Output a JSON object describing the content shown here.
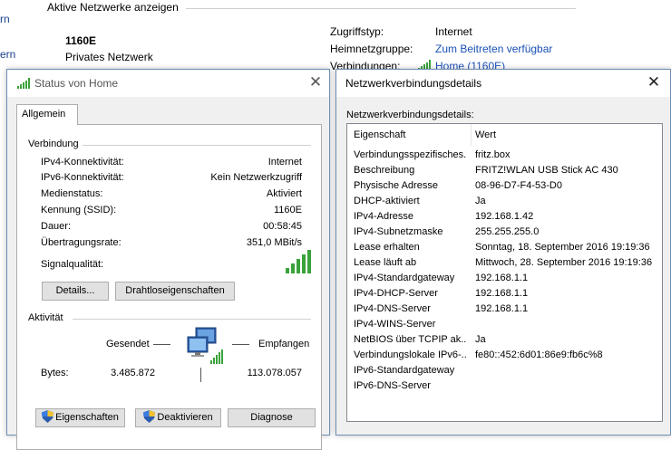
{
  "background": {
    "left_links": [
      "rn",
      "ern"
    ],
    "group_title": "Aktive Netzwerke anzeigen",
    "network_name": "1160E",
    "network_type": "Privates Netzwerk",
    "access_type_label": "Zugriffstyp:",
    "access_type_value": "Internet",
    "homegroup_label": "Heimnetzgruppe:",
    "homegroup_value": "Zum Beitreten verfügbar",
    "connections_label": "Verbindungen:",
    "connections_value": "Home (1160E)"
  },
  "status_dialog": {
    "title": "Status von Home",
    "tab_label": "Allgemein",
    "connection_group": "Verbindung",
    "rows": [
      {
        "label": "IPv4-Konnektivität:",
        "value": "Internet"
      },
      {
        "label": "IPv6-Konnektivität:",
        "value": "Kein Netzwerkzugriff"
      },
      {
        "label": "Medienstatus:",
        "value": "Aktiviert"
      },
      {
        "label": "Kennung (SSID):",
        "value": "1160E"
      },
      {
        "label": "Dauer:",
        "value": "00:58:45"
      },
      {
        "label": "Übertragungsrate:",
        "value": "351,0 MBit/s"
      }
    ],
    "signal_label": "Signalqualität:",
    "signal_bars_lit": 5,
    "signal_bars_total": 5,
    "details_button": "Details...",
    "wireless_props_button": "Drahtloseigenschaften",
    "activity_group": "Aktivität",
    "sent_label": "Gesendet",
    "received_label": "Empfangen",
    "bytes_label": "Bytes:",
    "bytes_sent": "3.485.872",
    "bytes_received": "113.078.057",
    "properties_button": "Eigenschaften",
    "deactivate_button": "Deaktivieren",
    "diagnose_button": "Diagnose"
  },
  "details_dialog": {
    "title": "Netzwerkverbindungsdetails",
    "caption": "Netzwerkverbindungsdetails:",
    "col_property": "Eigenschaft",
    "col_value": "Wert",
    "rows": [
      {
        "property": "Verbindungsspezifisches...",
        "value": "fritz.box"
      },
      {
        "property": "Beschreibung",
        "value": "FRITZ!WLAN USB Stick AC 430"
      },
      {
        "property": "Physische Adresse",
        "value": "08-96-D7-F4-53-D0"
      },
      {
        "property": "DHCP-aktiviert",
        "value": "Ja"
      },
      {
        "property": "IPv4-Adresse",
        "value": "192.168.1.42"
      },
      {
        "property": "IPv4-Subnetzmaske",
        "value": "255.255.255.0"
      },
      {
        "property": "Lease erhalten",
        "value": "Sonntag, 18. September 2016 19:19:36"
      },
      {
        "property": "Lease läuft ab",
        "value": "Mittwoch, 28. September 2016 19:19:36"
      },
      {
        "property": "IPv4-Standardgateway",
        "value": "192.168.1.1"
      },
      {
        "property": "IPv4-DHCP-Server",
        "value": "192.168.1.1"
      },
      {
        "property": "IPv4-DNS-Server",
        "value": "192.168.1.1"
      },
      {
        "property": "IPv4-WINS-Server",
        "value": ""
      },
      {
        "property": "NetBIOS über TCPIP ak...",
        "value": "Ja"
      },
      {
        "property": "Verbindungslokale IPv6-...",
        "value": "fe80::452:6d01:86e9:fb6c%8"
      },
      {
        "property": "IPv6-Standardgateway",
        "value": ""
      },
      {
        "property": "IPv6-DNS-Server",
        "value": ""
      }
    ]
  },
  "colors": {
    "link": "#1a50b5",
    "signal_green": "#3aa23a",
    "button_face": "#e1e1e1"
  },
  "icons": [
    "signal-icon",
    "network-computers-icon",
    "shield-icon",
    "close-icon"
  ]
}
